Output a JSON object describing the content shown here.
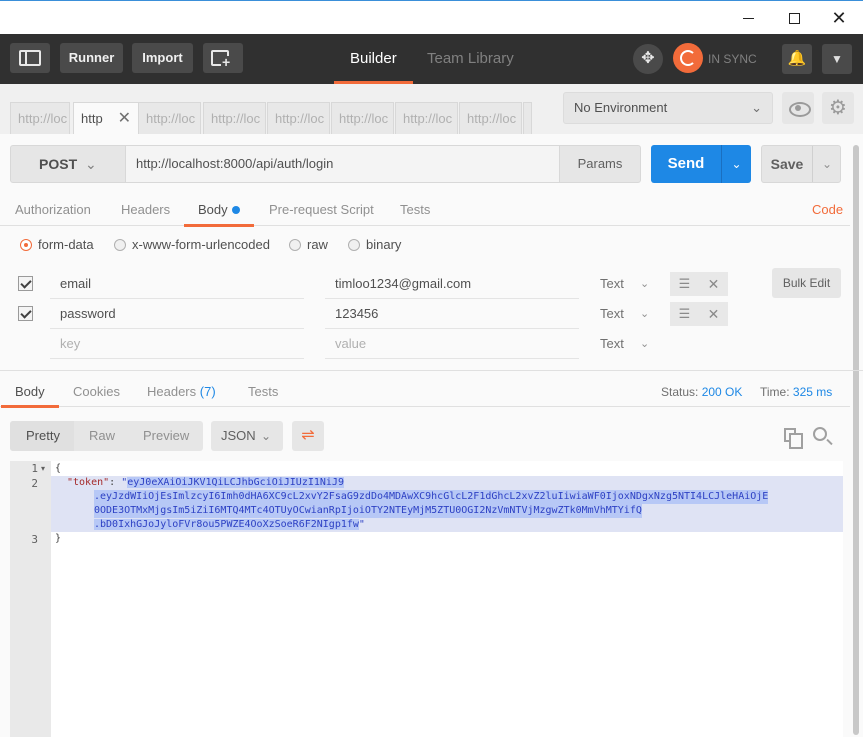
{
  "app": {
    "buttons": {
      "runner": "Runner",
      "import": "Import"
    },
    "tabs": [
      "Builder",
      "Team Library"
    ],
    "sync_status": "IN SYNC"
  },
  "request_tabs": [
    "http://loc",
    "http",
    "http://loc",
    "http://loc",
    "http://loc",
    "http://loc",
    "http://loc",
    "http://loc"
  ],
  "environment": {
    "selected": "No Environment"
  },
  "request": {
    "method": "POST",
    "url": "http://localhost:8000/api/auth/login",
    "params_label": "Params",
    "send_label": "Send",
    "save_label": "Save",
    "tabs": [
      "Authorization",
      "Headers",
      "Body",
      "Pre-request Script",
      "Tests"
    ],
    "code_link": "Code",
    "body_modes": [
      "form-data",
      "x-www-form-urlencoded",
      "raw",
      "binary"
    ],
    "form_rows": [
      {
        "key": "email",
        "value": "timloo1234@gmail.com",
        "type": "Text"
      },
      {
        "key": "password",
        "value": "123456",
        "type": "Text"
      }
    ],
    "placeholder_row": {
      "key": "key",
      "value": "value",
      "type": "Text"
    },
    "bulk_edit_label": "Bulk Edit"
  },
  "response": {
    "tabs": {
      "body": "Body",
      "cookies": "Cookies",
      "headers": "Headers",
      "headers_count": "(7)",
      "tests": "Tests"
    },
    "status_label": "Status:",
    "status_value": "200 OK",
    "time_label": "Time:",
    "time_value": "325 ms",
    "formats": [
      "Pretty",
      "Raw",
      "Preview"
    ],
    "language": "JSON",
    "lines": [
      "1",
      "2",
      "3"
    ],
    "code": {
      "open": "{",
      "key": "\"token\"",
      "colon": ": ",
      "quote": "\"",
      "token_1": "eyJ0eXAiOiJKV1QiLCJhbGciOiJIUzI1NiJ9",
      "token_2": ".eyJzdWIiOjEsImlzcyI6Imh0dHA6XC9cL2xvY2FsaG9zdDo4MDAwXC9hcGlcL2F1dGhcL2xvZ2luIiwiaWF0IjoxNDgxNzg5NTI4LCJleHAiOjE",
      "token_3": "0ODE3OTMxMjgsIm5iZiI6MTQ4MTc4OTUyOCwianRpIjoiOTY2NTEyMjM5ZTU0OGI2NzVmNTVjMzgwZTk0MmVhMTYifQ",
      "token_4": ".bD0IxhGJoJyloFVr8ou5PWZE4OoXzSoeR6F2NIgp1fw",
      "close": "}"
    }
  }
}
